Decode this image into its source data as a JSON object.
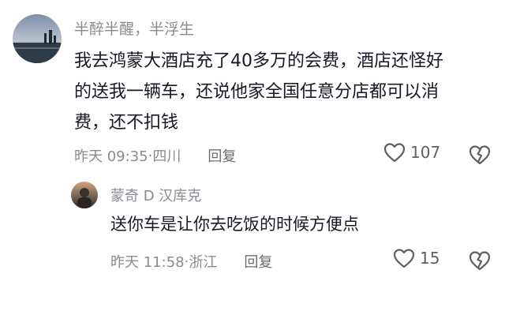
{
  "comments": [
    {
      "username": "半醉半醒，半浮生",
      "content_lines": [
        "我去鸿蒙大酒店充了40多万的会费，酒店还怪好",
        "的送我一辆车，还说他家全国任意分店都可以消",
        "费，还不扣钱"
      ],
      "time": "昨天 09:35",
      "location": "四川",
      "reply_label": "回复",
      "likes": "107"
    },
    {
      "username": "蒙奇 D 汉库克",
      "content_lines": [
        "送你车是让你去吃饭的时候方便点"
      ],
      "time": "昨天 11:58",
      "location": "浙江",
      "reply_label": "回复",
      "likes": "15"
    }
  ],
  "icons": {
    "like": "heart-outline-icon",
    "dislike": "broken-heart-icon"
  },
  "colors": {
    "text_primary": "#161823",
    "text_secondary": "#8a8b91",
    "icon": "#5f6066"
  }
}
